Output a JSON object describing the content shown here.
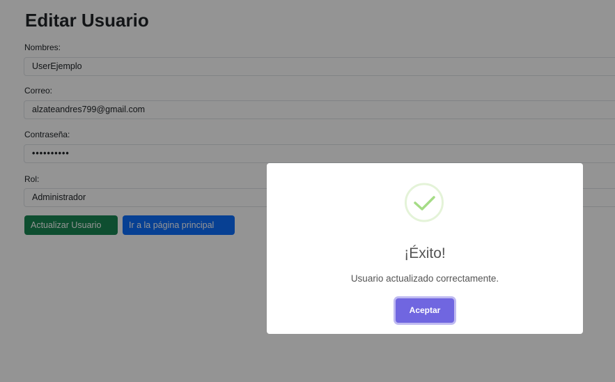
{
  "form": {
    "title": "Editar Usuario",
    "fields": [
      {
        "label": "Nombres:",
        "value": "UserEjemplo"
      },
      {
        "label": "Correo:",
        "value": "alzateandres799@gmail.com"
      },
      {
        "label": "Contraseña:",
        "value": "••••••••••"
      },
      {
        "label": "Rol:",
        "value": "Administrador"
      }
    ],
    "buttons": {
      "update": "Actualizar Usuario",
      "home": "Ir a la página principal"
    }
  },
  "modal": {
    "icon": "success-check-icon",
    "title": "¡Éxito!",
    "message": "Usuario actualizado correctamente.",
    "confirm": "Aceptar"
  },
  "colors": {
    "update_button": "#198754",
    "home_button": "#0d6efd",
    "confirm_button": "#7066e0",
    "success_icon": "#a5dc86"
  }
}
